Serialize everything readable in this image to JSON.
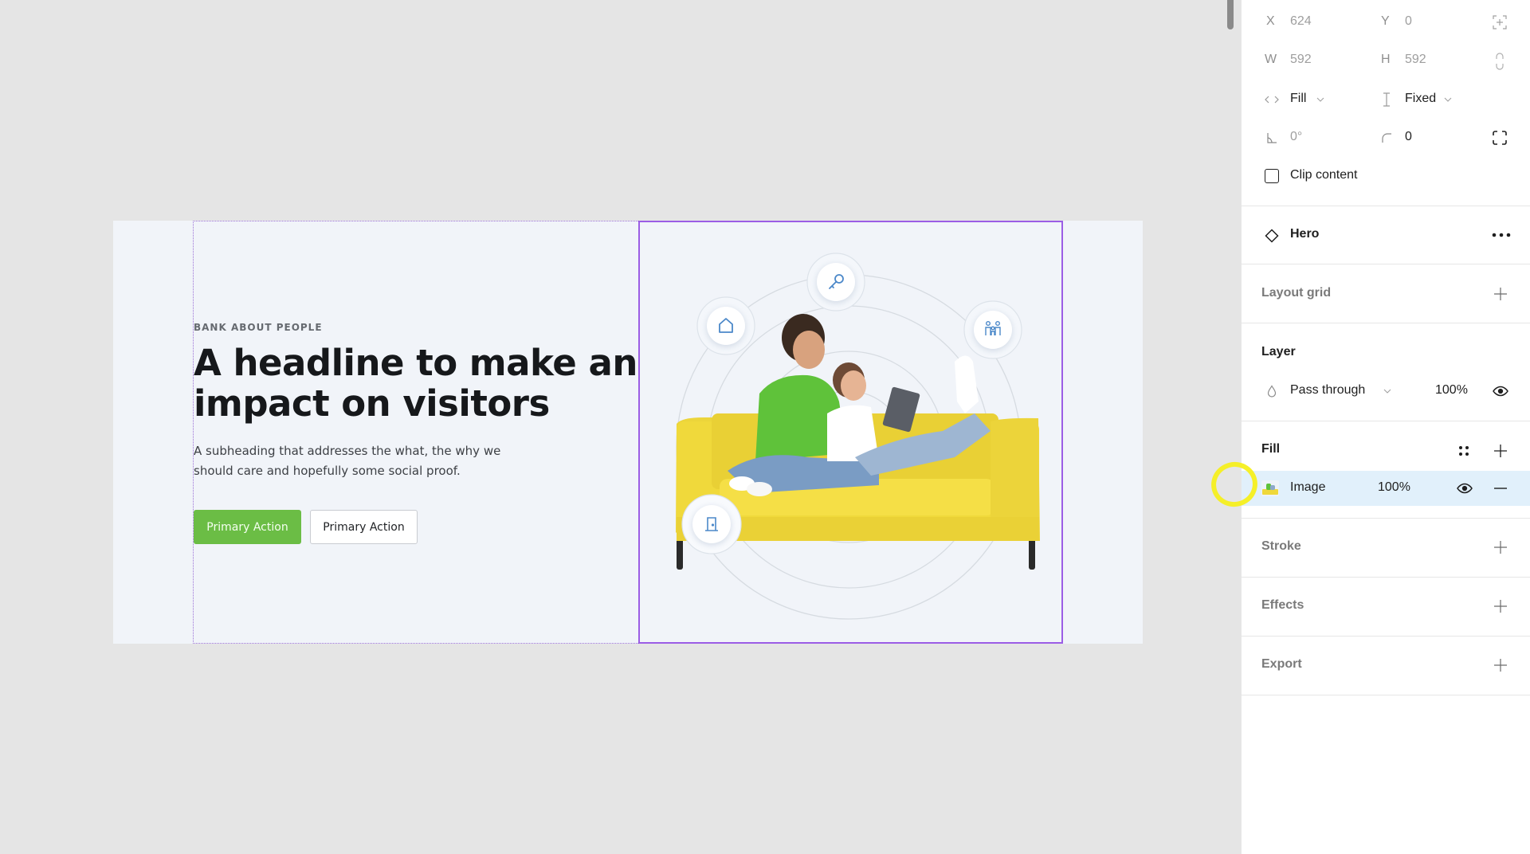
{
  "canvas": {
    "frame_name": "Hero",
    "hero": {
      "eyebrow": "BANK ABOUT PEOPLE",
      "headline": "A headline to make an impact on visitors",
      "subheading": "A subheading that addresses the what, the why we should care and hopefully some social proof.",
      "primary_button": "Primary Action",
      "secondary_button": "Primary Action",
      "image_icons": [
        "home-icon",
        "key-icon",
        "family-icon",
        "door-icon"
      ],
      "colors": {
        "background": "#f1f4f9",
        "primary": "#6bbd45",
        "sofa": "#f2dc3c",
        "shirt": "#62c63a",
        "selection": "#9b5de5"
      }
    }
  },
  "panel": {
    "position": {
      "x_label": "X",
      "x_value": "624",
      "y_label": "Y",
      "y_value": "0"
    },
    "size": {
      "w_label": "W",
      "w_value": "592",
      "h_label": "H",
      "h_value": "592"
    },
    "resizing": {
      "horizontal": "Fill",
      "vertical": "Fixed"
    },
    "rotation": "0°",
    "corner_radius": "0",
    "clip_content_label": "Clip content",
    "clip_content_checked": false,
    "component": {
      "name": "Hero"
    },
    "layout_grid": {
      "title": "Layout grid"
    },
    "layer": {
      "title": "Layer",
      "blend_mode": "Pass through",
      "opacity": "100%"
    },
    "fill": {
      "title": "Fill",
      "items": [
        {
          "type": "Image",
          "opacity": "100%"
        }
      ]
    },
    "stroke": {
      "title": "Stroke"
    },
    "effects": {
      "title": "Effects"
    },
    "export": {
      "title": "Export"
    }
  }
}
